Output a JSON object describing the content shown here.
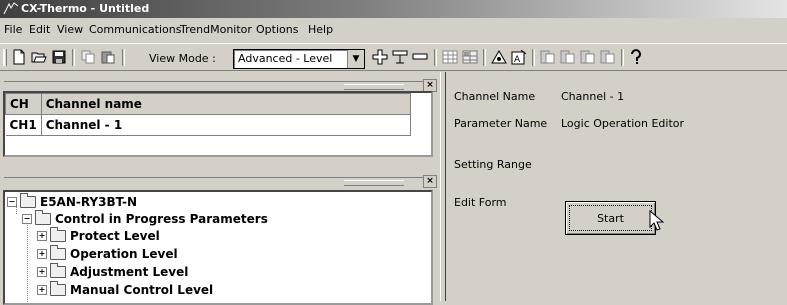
{
  "window": {
    "title": "CX-Thermo - Untitled"
  },
  "menu": [
    "File",
    "Edit",
    "View",
    "Communications",
    "TrendMonitor",
    "Options",
    "Help"
  ],
  "toolbar": {
    "view_mode_label": "View Mode :",
    "view_mode_value": "Advanced - Level"
  },
  "channel_list": {
    "headers": [
      "CH",
      "Channel name"
    ],
    "rows": [
      [
        "CH1",
        "Channel - 1"
      ]
    ]
  },
  "tree": {
    "root": "E5AN-RY3BT-N",
    "group": "Control in Progress Parameters",
    "items": [
      "Protect Level",
      "Operation Level",
      "Adjustment Level",
      "Manual Control Level"
    ]
  },
  "details": {
    "channel_name_label": "Channel Name",
    "channel_name_value": "Channel - 1",
    "parameter_name_label": "Parameter Name",
    "parameter_name_value": "Logic Operation Editor",
    "setting_range_label": "Setting Range",
    "edit_form_label": "Edit Form",
    "start_button": "Start"
  }
}
